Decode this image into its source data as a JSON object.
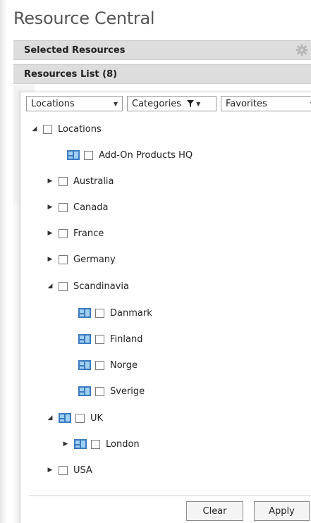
{
  "app": {
    "title": "Resource Central"
  },
  "sections": {
    "selected_label": "Selected Resources",
    "list_label": "Resources List (8)"
  },
  "filters": {
    "locations": "Locations",
    "categories": "Categories",
    "favorites": "Favorites"
  },
  "tree": {
    "root": "Locations",
    "items": [
      {
        "label": "Add-On Products HQ"
      },
      {
        "label": "Australia"
      },
      {
        "label": "Canada"
      },
      {
        "label": "France"
      },
      {
        "label": "Germany"
      },
      {
        "label": "Scandinavia"
      },
      {
        "label": "Danmark"
      },
      {
        "label": "Finland"
      },
      {
        "label": "Norge"
      },
      {
        "label": "Sverige"
      },
      {
        "label": "UK"
      },
      {
        "label": "London"
      },
      {
        "label": "USA"
      }
    ]
  },
  "buttons": {
    "clear": "Clear",
    "apply": "Apply"
  },
  "colors": {
    "bar_bg": "#dddddd",
    "resource_icon": "#3b7bbf"
  }
}
